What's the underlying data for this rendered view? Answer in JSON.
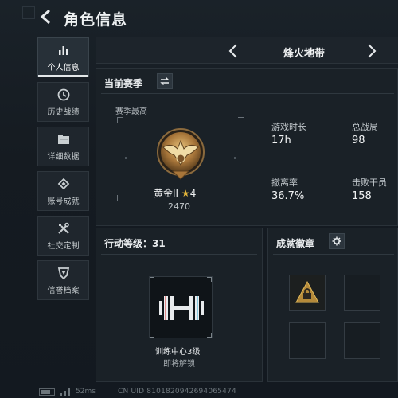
{
  "header": {
    "title": "角色信息"
  },
  "sidebar": {
    "items": [
      {
        "label": "个人信息",
        "icon": "bar-chart-icon",
        "active": true
      },
      {
        "label": "历史战绩",
        "icon": "history-icon"
      },
      {
        "label": "详细数据",
        "icon": "folder-icon"
      },
      {
        "label": "账号成就",
        "icon": "medal-icon"
      },
      {
        "label": "社交定制",
        "icon": "tools-icon"
      },
      {
        "label": "信誉档案",
        "icon": "shield-icon"
      }
    ]
  },
  "map_selector": {
    "name": "烽火地带"
  },
  "season": {
    "title": "当前赛季",
    "best_label": "赛季最高",
    "rank_name": "黄金II",
    "rank_star": "★",
    "rank_stars": "4",
    "rank_score": "2470",
    "stats": [
      {
        "label": "游戏时长",
        "value": "17h"
      },
      {
        "label": "总战局",
        "value": "98"
      },
      {
        "label": "撤离率",
        "value": "36.7%"
      },
      {
        "label": "击败干员",
        "value": "158"
      }
    ]
  },
  "action_level": {
    "title": "行动等级：31",
    "training_name": "训练中心3级",
    "training_status": "即将解锁"
  },
  "achievements": {
    "title": "成就徽章"
  },
  "footer": {
    "ping": "52ms",
    "uid": "CN UID 8101820942694065474"
  },
  "colors": {
    "background": "#151b21",
    "panel": "#1a2127",
    "gold": "#b8863a",
    "star": "#e2b53b"
  }
}
